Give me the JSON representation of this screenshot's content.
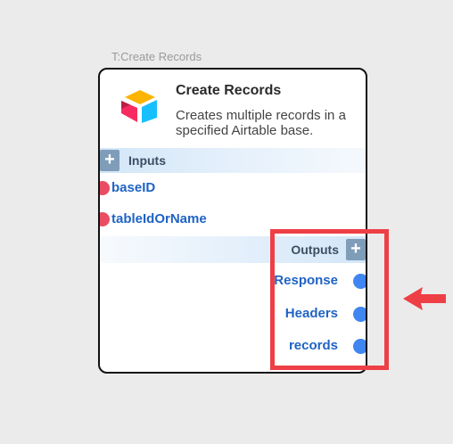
{
  "node": {
    "type_label": "T:Create Records",
    "title": "Create Records",
    "description": "Creates multiple records in a specified Airtable base.",
    "logo_icon": "airtable-logo"
  },
  "inputs": {
    "label": "Inputs",
    "add_icon": "+",
    "items": [
      {
        "label": "baseID"
      },
      {
        "label": "tableIdOrName"
      }
    ]
  },
  "outputs": {
    "label": "Outputs",
    "add_icon": "+",
    "items": [
      {
        "label": "Response"
      },
      {
        "label": "Headers"
      },
      {
        "label": "records"
      }
    ]
  },
  "colors": {
    "input_port": "#ea4d61",
    "output_port": "#3f86f0",
    "highlight": "#ee3f46",
    "label_blue": "#1f63c4"
  }
}
